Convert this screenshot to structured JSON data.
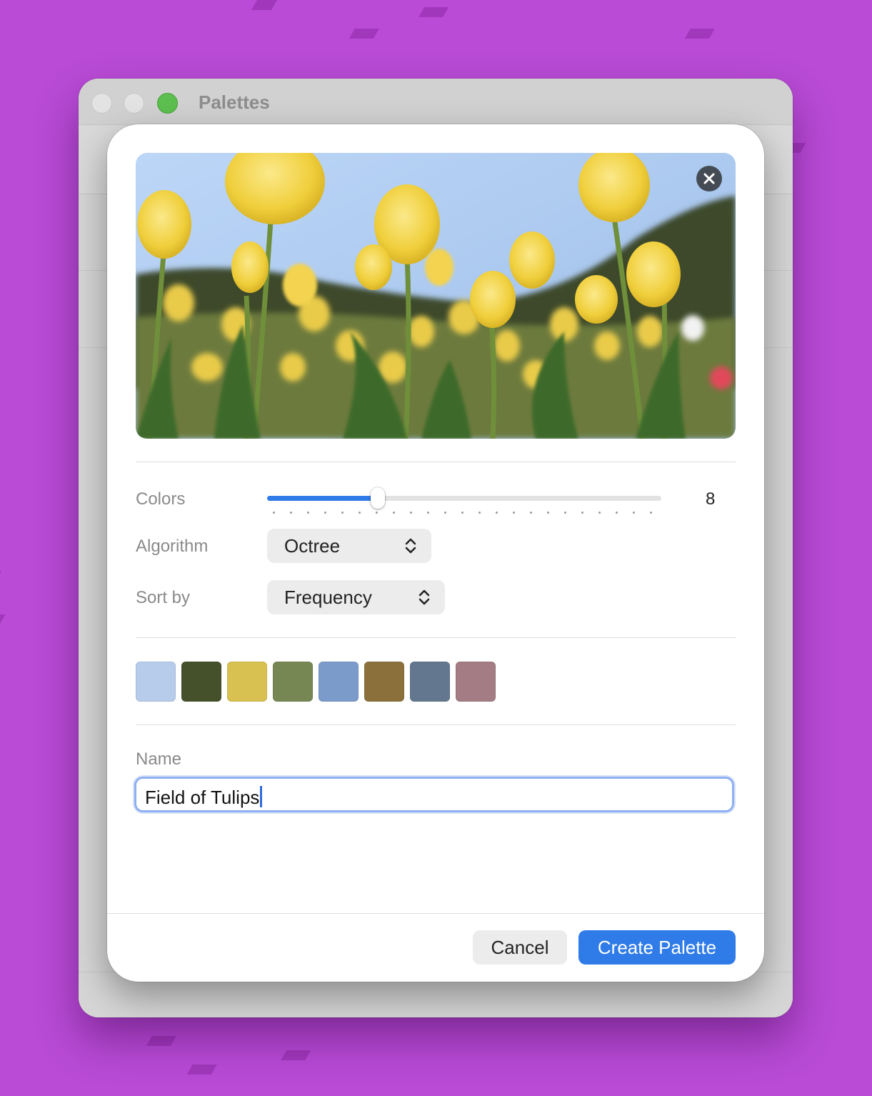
{
  "window": {
    "title": "Palettes"
  },
  "sheet": {
    "image": {
      "description_icon": "photo-thumbnail",
      "close_icon": "close-icon"
    },
    "colors": {
      "label": "Colors",
      "value": "8",
      "slider_fraction": 0.28,
      "tick_count": 23
    },
    "algorithm": {
      "label": "Algorithm",
      "selected": "Octree"
    },
    "sort_by": {
      "label": "Sort by",
      "selected": "Frequency"
    },
    "swatches": [
      "#b7ccea",
      "#44512a",
      "#d8c151",
      "#778754",
      "#7b9bcb",
      "#8c703c",
      "#63788f",
      "#a37c84"
    ],
    "name": {
      "label": "Name",
      "value": "Field of Tulips"
    },
    "buttons": {
      "cancel": "Cancel",
      "create": "Create Palette"
    },
    "accent_color": "#2f7be8"
  }
}
